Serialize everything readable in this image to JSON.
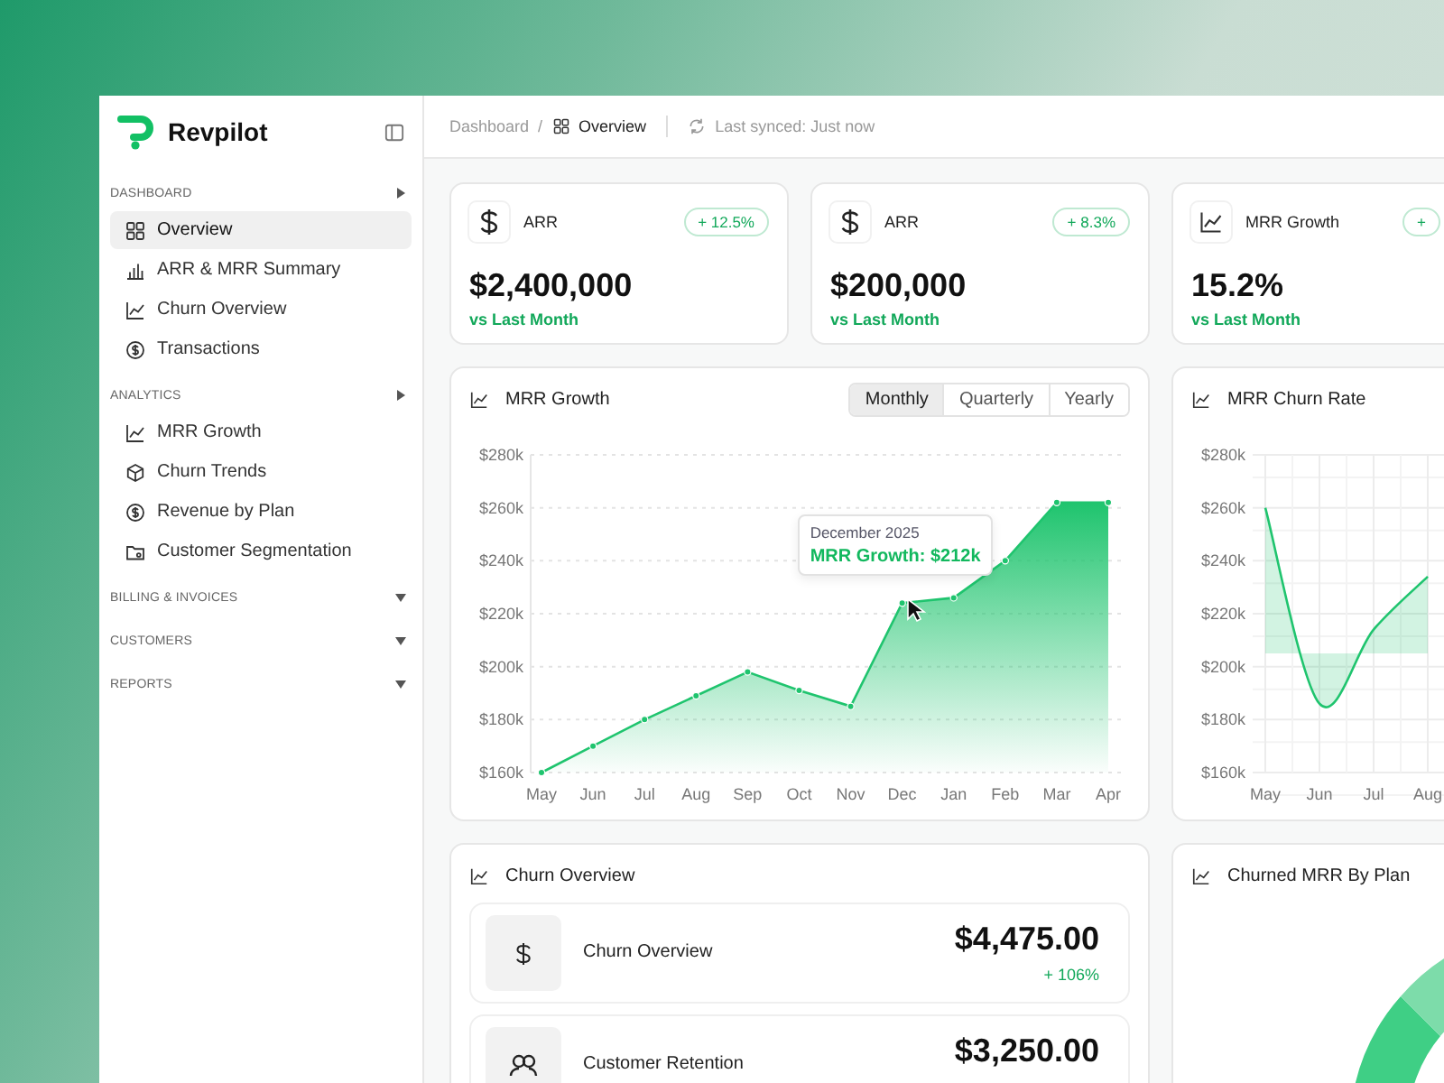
{
  "app": {
    "name": "Revpilot"
  },
  "sidebar": {
    "sections": [
      {
        "label": "DASHBOARD",
        "expanded": true,
        "items": [
          {
            "label": "Overview",
            "selected": true
          },
          {
            "label": "ARR & MRR Summary",
            "selected": false
          },
          {
            "label": "Churn Overview",
            "selected": false
          },
          {
            "label": "Transactions",
            "selected": false
          }
        ]
      },
      {
        "label": "ANALYTICS",
        "expanded": true,
        "items": [
          {
            "label": "MRR Growth",
            "selected": false
          },
          {
            "label": "Churn Trends",
            "selected": false
          },
          {
            "label": "Revenue by Plan",
            "selected": false
          },
          {
            "label": "Customer Segmentation",
            "selected": false
          }
        ]
      },
      {
        "label": "BILLING & INVOICES",
        "expanded": false
      },
      {
        "label": "CUSTOMERS",
        "expanded": false
      },
      {
        "label": "REPORTS",
        "expanded": false
      }
    ]
  },
  "breadcrumb": {
    "items": [
      "Dashboard",
      "Overview"
    ],
    "separator": "/"
  },
  "sync_status": "Last synced: Just now",
  "kpis": [
    {
      "kind": "currency",
      "label": "ARR",
      "badge": "+ 12.5%",
      "value": "$2,400,000",
      "note": "vs Last Month"
    },
    {
      "kind": "currency",
      "label": "ARR",
      "badge": "+ 8.3%",
      "value": "$200,000",
      "note": "vs Last Month"
    },
    {
      "kind": "growth",
      "label": "MRR Growth",
      "badge": "+",
      "value": "15.2%",
      "note": "vs Last Month"
    }
  ],
  "mrr_growth": {
    "title": "MRR Growth",
    "periods": [
      {
        "label": "Monthly",
        "selected": true
      },
      {
        "label": "Quarterly",
        "selected": false
      },
      {
        "label": "Yearly",
        "selected": false
      }
    ],
    "chart_data": {
      "type": "area",
      "grid": true,
      "categories": [
        "May",
        "Jun",
        "Jul",
        "Aug",
        "Sep",
        "Oct",
        "Nov",
        "Dec",
        "Jan",
        "Feb",
        "Mar",
        "Apr"
      ],
      "series": [
        {
          "color": "#1fc46e",
          "values": [
            160,
            170,
            180,
            189,
            198,
            191,
            185,
            224,
            226,
            240,
            262,
            262
          ]
        }
      ],
      "ylim": [
        160,
        280
      ],
      "yticks": [
        {
          "value": 160,
          "label": "$160k"
        },
        {
          "value": 180,
          "label": "$180k"
        },
        {
          "value": 200,
          "label": "$200k"
        },
        {
          "value": 220,
          "label": "$220k"
        },
        {
          "value": 240,
          "label": "$240k"
        },
        {
          "value": 260,
          "label": "$260k"
        },
        {
          "value": 280,
          "label": "$280k"
        }
      ],
      "annotations": [
        "December 2025",
        "MRR Growth: $212k"
      ]
    }
  },
  "churn_rate": {
    "title": "MRR Churn Rate",
    "chart_data": {
      "type": "area",
      "grid": true,
      "categories": [
        "May",
        "Jun",
        "Jul",
        "Aug"
      ],
      "series": [
        {
          "color": "#1fc46e",
          "values": [
            260,
            186,
            214,
            234
          ]
        }
      ],
      "ylim": [
        160,
        280
      ],
      "yticks": [
        {
          "value": 160,
          "label": "$160k"
        },
        {
          "value": 180,
          "label": "$180k"
        },
        {
          "value": 200,
          "label": "$200k"
        },
        {
          "value": 220,
          "label": "$220k"
        },
        {
          "value": 240,
          "label": "$240k"
        },
        {
          "value": 260,
          "label": "$260k"
        },
        {
          "value": 280,
          "label": "$280k"
        }
      ]
    }
  },
  "churn_overview": {
    "title": "Churn Overview",
    "items": [
      {
        "label": "Churn Overview",
        "value": "$4,475.00",
        "change": "+ 106%"
      },
      {
        "label": "Customer Retention",
        "value": "$3,250.00"
      }
    ]
  },
  "churned_by_plan": {
    "title": "Churned MRR By Plan"
  }
}
